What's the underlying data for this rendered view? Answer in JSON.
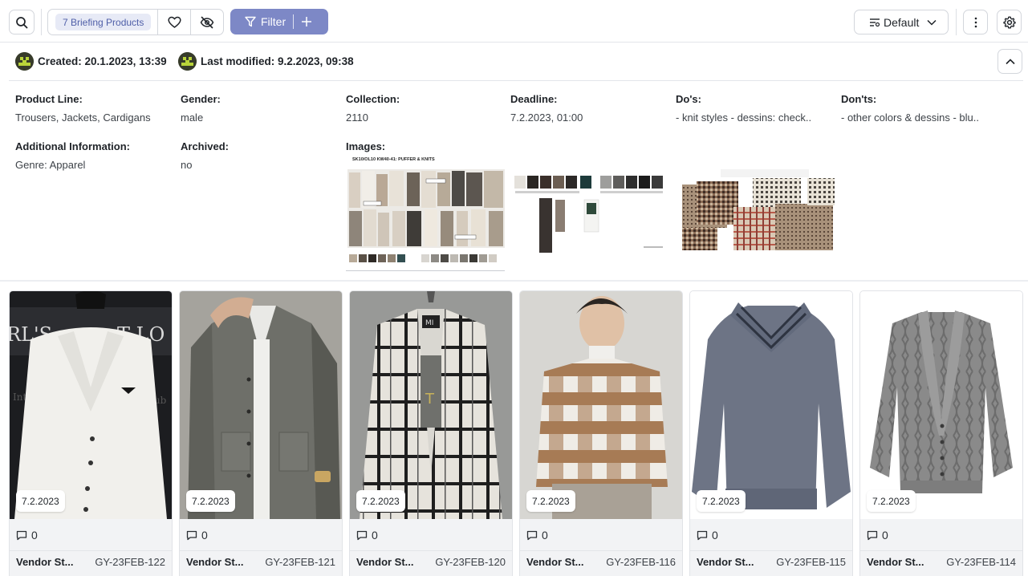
{
  "toolbar": {
    "briefing_chip": "7 Briefing Products",
    "filter_label": "Filter",
    "sort_label": "Default"
  },
  "meta": {
    "created": "Created: 20.1.2023, 13:39",
    "modified": "Last modified: 9.2.2023, 09:38"
  },
  "details": {
    "product_line": {
      "label": "Product Line:",
      "value": "Trousers, Jackets, Cardigans"
    },
    "gender": {
      "label": "Gender:",
      "value": "male"
    },
    "collection": {
      "label": "Collection:",
      "value": "2110"
    },
    "deadline": {
      "label": "Deadline:",
      "value": "7.2.2023, 01:00"
    },
    "dos": {
      "label": "Do's:",
      "value": "- knit styles - dessins: check.."
    },
    "donts": {
      "label": "Don'ts:",
      "value": "- other colors & dessins - blu.."
    },
    "additional": {
      "label": "Additional Information:",
      "value": "Genre: Apparel"
    },
    "archived": {
      "label": "Archived:",
      "value": "no"
    },
    "images": {
      "label": "Images:"
    }
  },
  "moodboard": {
    "title": "SK10/OL10 KW40-41: PUFFER & KNITS"
  },
  "products": [
    {
      "date": "7.2.2023",
      "comments": "0",
      "vendor": "Vendor St...",
      "sku": "GY-23FEB-122"
    },
    {
      "date": "7.2.2023",
      "comments": "0",
      "vendor": "Vendor St...",
      "sku": "GY-23FEB-121"
    },
    {
      "date": "7.2.2023",
      "comments": "0",
      "vendor": "Vendor St...",
      "sku": "GY-23FEB-120"
    },
    {
      "date": "7.2.2023",
      "comments": "0",
      "vendor": "Vendor St...",
      "sku": "GY-23FEB-116"
    },
    {
      "date": "7.2.2023",
      "comments": "0",
      "vendor": "Vendor St...",
      "sku": "GY-23FEB-115"
    },
    {
      "date": "7.2.2023",
      "comments": "0",
      "vendor": "Vendor St...",
      "sku": "GY-23FEB-114"
    }
  ],
  "icons": {
    "search": "search-icon",
    "heart": "heart-icon",
    "hidden": "eye-off-icon",
    "filter": "filter-icon",
    "plus": "plus-icon",
    "sort": "sort-lines-icon",
    "chevron_down": "chevron-down-icon",
    "more": "more-vertical-icon",
    "settings": "gear-icon",
    "chevron_up": "chevron-up-icon",
    "comment": "comment-icon"
  },
  "colors": {
    "accent": "#7d88c6",
    "chip_bg": "#e7eaf6",
    "chip_text": "#4f5fa8"
  }
}
